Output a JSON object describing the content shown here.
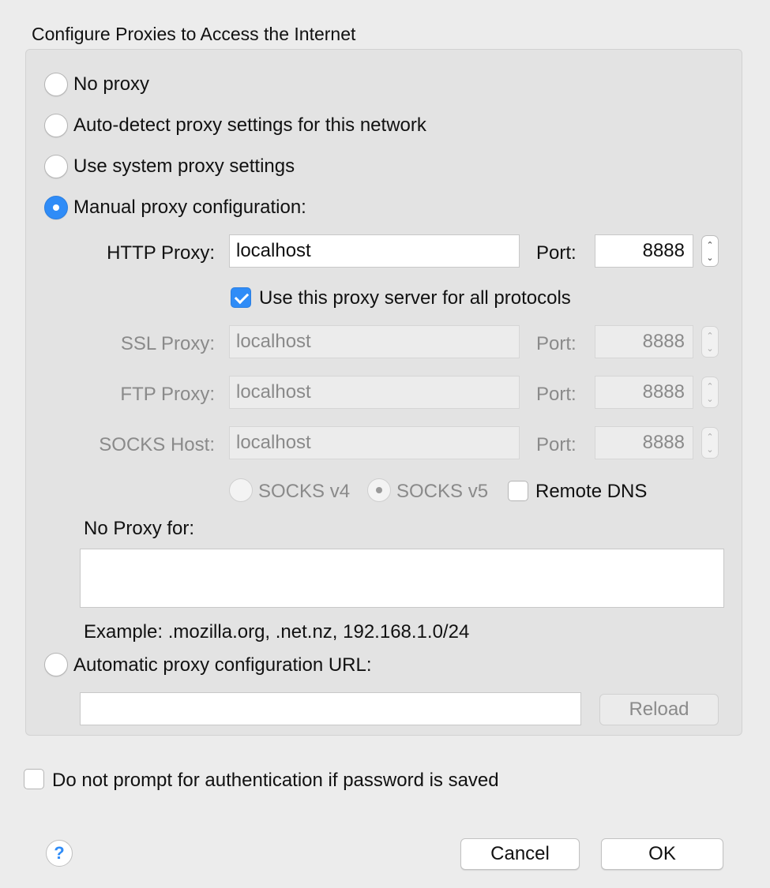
{
  "title": "Configure Proxies to Access the Internet",
  "options": {
    "no_proxy": "No proxy",
    "auto_detect": "Auto-detect proxy settings for this network",
    "system": "Use system proxy settings",
    "manual": "Manual proxy configuration:",
    "auto_url": "Automatic proxy configuration URL:"
  },
  "selected_option": "manual",
  "manual": {
    "http_label": "HTTP Proxy:",
    "http_value": "localhost",
    "port_label": "Port:",
    "http_port": "8888",
    "use_for_all_label": "Use this proxy server for all protocols",
    "use_for_all_checked": true,
    "ssl_label": "SSL Proxy:",
    "ssl_value": "localhost",
    "ssl_port": "8888",
    "ftp_label": "FTP Proxy:",
    "ftp_value": "localhost",
    "ftp_port": "8888",
    "socks_label": "SOCKS Host:",
    "socks_value": "localhost",
    "socks_port": "8888",
    "socks_v4": "SOCKS v4",
    "socks_v5": "SOCKS v5",
    "remote_dns": "Remote DNS",
    "no_proxy_label": "No Proxy for:",
    "no_proxy_value": "",
    "example": "Example: .mozilla.org, .net.nz, 192.168.1.0/24"
  },
  "auto_url": {
    "value": "",
    "reload_label": "Reload"
  },
  "no_prompt_label": "Do not prompt for authentication if password is saved",
  "buttons": {
    "help": "?",
    "cancel": "Cancel",
    "ok": "OK"
  },
  "colors": {
    "accent": "#2f8cf7",
    "background": "#ececec",
    "group_background": "#e3e3e3",
    "disabled_text": "#8a8a8a"
  }
}
